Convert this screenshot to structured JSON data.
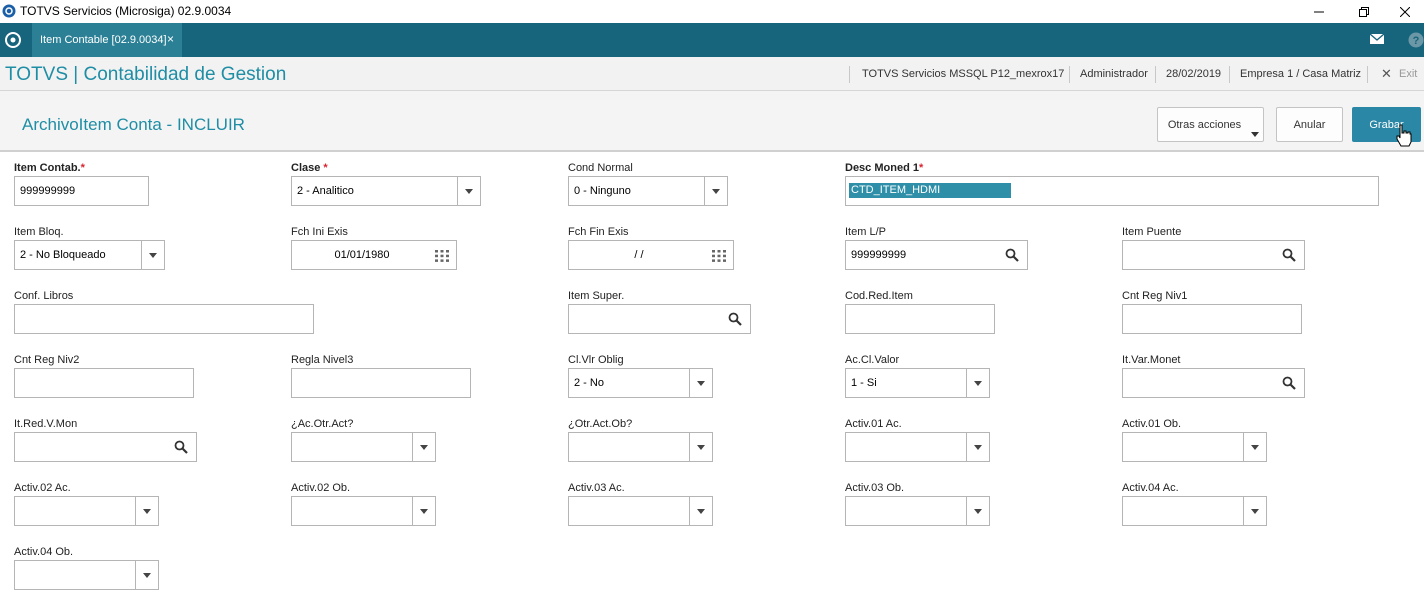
{
  "window": {
    "title": "TOTVS Servicios (Microsiga) 02.9.0034"
  },
  "tabbar": {
    "tab_label": "Item Contable [02.9.0034]",
    "tab_close": "×"
  },
  "header": {
    "app_title": "TOTVS | Contabilidad de Gestion",
    "environment": "TOTVS Servicios MSSQL P12_mexrox17",
    "user": "Administrador",
    "date": "28/02/2019",
    "company": "Empresa 1 / Casa Matriz",
    "exit_label": "Exit"
  },
  "toolbar": {
    "form_title": "ArchivoItem Conta - INCLUIR",
    "other_actions": "Otras acciones",
    "cancel": "Anular",
    "save": "Grabar"
  },
  "fields": {
    "item_contab": {
      "label": "Item Contab.",
      "required": "*",
      "value": "999999999"
    },
    "clase": {
      "label": "Clase",
      "required": "*",
      "value": "2 - Analitico"
    },
    "cond_normal": {
      "label": "Cond Normal",
      "value": "0 - Ninguno"
    },
    "desc_moned1": {
      "label": "Desc Moned 1",
      "required": "*",
      "value": "CTD_ITEM_HDMI"
    },
    "item_bloq": {
      "label": "Item Bloq.",
      "value": "2 - No Bloqueado"
    },
    "fch_ini_exis": {
      "label": "Fch Ini Exis",
      "value": "01/01/1980"
    },
    "fch_fin_exis": {
      "label": "Fch Fin Exis",
      "value": "/ /"
    },
    "item_lp": {
      "label": "Item L/P",
      "value": "999999999"
    },
    "item_puente": {
      "label": "Item Puente",
      "value": ""
    },
    "conf_libros": {
      "label": "Conf. Libros",
      "value": ""
    },
    "item_super": {
      "label": "Item Super.",
      "value": ""
    },
    "cod_red_item": {
      "label": "Cod.Red.Item",
      "value": ""
    },
    "cnt_reg_niv1": {
      "label": "Cnt Reg Niv1",
      "value": ""
    },
    "cnt_reg_niv2": {
      "label": "Cnt Reg Niv2",
      "value": ""
    },
    "regla_nivel3": {
      "label": "Regla Nivel3",
      "value": ""
    },
    "cl_vlr_oblig": {
      "label": "Cl.Vlr Oblig",
      "value": "2 - No"
    },
    "ac_cl_valor": {
      "label": "Ac.Cl.Valor",
      "value": "1 - Si"
    },
    "it_var_monet": {
      "label": "It.Var.Monet",
      "value": ""
    },
    "it_red_v_mon": {
      "label": "It.Red.V.Mon",
      "value": ""
    },
    "ac_otr_act": {
      "label": "¿Ac.Otr.Act?",
      "value": ""
    },
    "otr_act_ob": {
      "label": "¿Otr.Act.Ob?",
      "value": ""
    },
    "activ01_ac": {
      "label": "Activ.01 Ac.",
      "value": ""
    },
    "activ01_ob": {
      "label": "Activ.01 Ob.",
      "value": ""
    },
    "activ02_ac": {
      "label": "Activ.02 Ac.",
      "value": ""
    },
    "activ02_ob": {
      "label": "Activ.02 Ob.",
      "value": ""
    },
    "activ03_ac": {
      "label": "Activ.03 Ac.",
      "value": ""
    },
    "activ03_ob": {
      "label": "Activ.03 Ob.",
      "value": ""
    },
    "activ04_ac": {
      "label": "Activ.04 Ac.",
      "value": ""
    },
    "activ04_ob": {
      "label": "Activ.04 Ob.",
      "value": ""
    }
  },
  "icons": {
    "app": "totvs-logo-icon",
    "home": "home-icon",
    "mail": "mail-icon",
    "help": "help-icon",
    "search": "search-icon",
    "calendar": "calendar-icon",
    "dropdown": "chevron-down-icon"
  },
  "colors": {
    "tabbar": "#17657c",
    "accent": "#1f8ea5",
    "primary_button": "#2a87a6",
    "required": "#d9232f",
    "selection": "#2f8fa8"
  }
}
